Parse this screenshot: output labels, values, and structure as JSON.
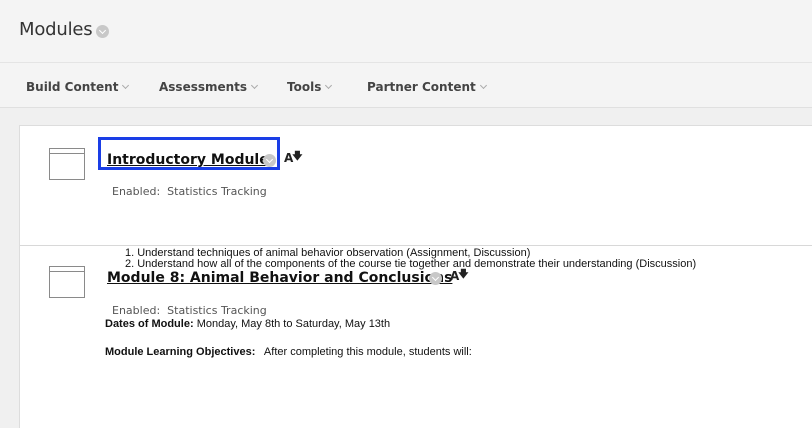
{
  "page": {
    "title": "Modules"
  },
  "toolbar": {
    "items": [
      {
        "label": "Build Content"
      },
      {
        "label": "Assessments"
      },
      {
        "label": "Tools"
      },
      {
        "label": "Partner Content"
      }
    ]
  },
  "modules": [
    {
      "title": "Introductory Module",
      "enabled_label": "Enabled:",
      "enabled_value": "Statistics Tracking",
      "highlighted": true
    },
    {
      "title": "Module 8: Animal Behavior and Conclusions",
      "enabled_label": "Enabled:",
      "enabled_value": "Statistics Tracking",
      "dates_label": "Dates of Module:",
      "dates_value": "Monday, May 8th to Saturday, May 13th",
      "objectives_label": "Module Learning Objectives:",
      "objectives_intro": "After completing this module, students will:",
      "objectives": [
        "1. Understand techniques of animal behavior observation (Assignment, Discussion)",
        "2. Understand how all of the components of the course tie together and demonstrate their understanding (Discussion)"
      ]
    }
  ],
  "colors": {
    "highlight_border": "#1a3ee6",
    "chevron_circle": "#c8c8c8"
  },
  "icons": {
    "title_menu": "chevron-circle-icon",
    "spellcheck": "text-sort-icon",
    "folder": "folder-icon"
  }
}
